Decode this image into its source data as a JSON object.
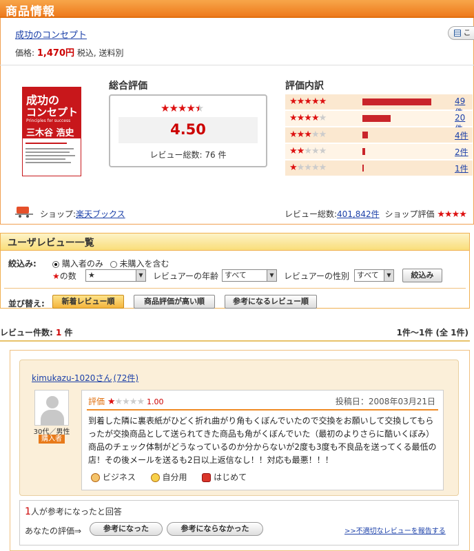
{
  "header": {
    "title": "商品情報"
  },
  "product": {
    "name": "成功のコンセプト",
    "price_label": "価格:",
    "price": "1,470円",
    "price_note": "税込, 送料別",
    "side_button": "こ",
    "cover": {
      "title1": "成功の",
      "title2": "コンセプト",
      "subtitle": "Principles for success",
      "author": "三木谷 浩史"
    }
  },
  "summary": {
    "heading": "総合評価",
    "score": "4.50",
    "stars": 4.5,
    "review_total_label": "レビュー総数:",
    "review_total": "76 件"
  },
  "breakdown": {
    "heading": "評価内訳",
    "rows": [
      {
        "stars": 5,
        "count": "49件",
        "fraction": 0.98
      },
      {
        "stars": 4,
        "count": "20件",
        "fraction": 0.4
      },
      {
        "stars": 3,
        "count": "4件",
        "fraction": 0.08
      },
      {
        "stars": 2,
        "count": "2件",
        "fraction": 0.04
      },
      {
        "stars": 1,
        "count": "1件",
        "fraction": 0.02
      }
    ]
  },
  "shop": {
    "label": "ショップ:",
    "name": "楽天ブックス",
    "review_label": "レビュー総数:",
    "review_count": "401,842件",
    "rating_label": "ショップ評価"
  },
  "filter": {
    "heading": "ユーザレビュー一覧",
    "narrow_label": "絞込み:",
    "opt_buyer": "購入者のみ",
    "opt_all": "未購入を含む",
    "stars_label": "の数",
    "stars_value": "★",
    "age_label": "レビュアーの年齢",
    "age_value": "すべて",
    "gender_label": "レビュアーの性別",
    "gender_value": "すべて",
    "apply_button": "絞込み",
    "sort_label": "並び替え:",
    "sort_new": "新着レビュー順",
    "sort_rating": "商品評価が高い順",
    "sort_helpful": "参考になるレビュー順"
  },
  "results": {
    "count_label": "レビュー件数:",
    "count": "1",
    "count_unit": "件",
    "range": "1件〜1件 (全 1件)"
  },
  "review": {
    "reviewer": "kimukazu-1020さん",
    "reviewer_count": "(72件)",
    "demographic": "30代／男性",
    "buyer_badge": "購入者",
    "rating_label": "評価",
    "rating_stars": 1,
    "rating_value": "1.00",
    "posted": "投稿日：2008年03月21日",
    "body": "到着した隣に裏表紙がひどく折れ曲がり角もくぼんでいたので交換をお願いして交換してもらったが交換商品として送られてきた商品も角がくぼんでいた（最初のよりさらに酷いくぼみ）商品のチェック体制がどうなっているのか分からないが2度も3度も不良品を送ってくる最低の店！その後メールを送るも2日以上返信なし！！対応も最悪！！！",
    "tags": [
      "ビジネス",
      "自分用",
      "はじめて"
    ],
    "helpful_count": "1",
    "helpful_text": "人が参考になったと回答",
    "your_rating": "あなたの評価⇒",
    "btn_helpful": "参考になった",
    "btn_not_helpful": "参考にならなかった",
    "report_link": ">>不適切なレビューを報告する"
  },
  "colors": {
    "accent": "#ee7a1c",
    "star": "#d11",
    "bar": "#c9242a",
    "link": "#1a3fa8"
  }
}
